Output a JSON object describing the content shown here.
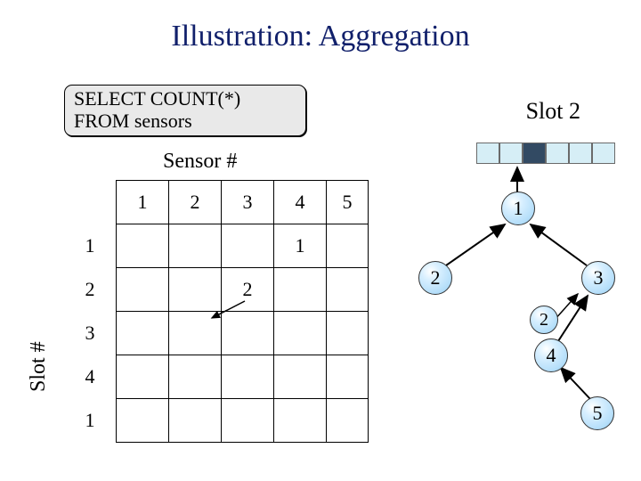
{
  "title": "Illustration: Aggregation",
  "sql": {
    "line1": "SELECT COUNT(*)",
    "line2": "FROM sensors"
  },
  "sensor_header": "Sensor #",
  "slot_axis": "Slot #",
  "col_headers": [
    "1",
    "2",
    "3",
    "4",
    "5"
  ],
  "row_headers": [
    "1",
    "2",
    "3",
    "4",
    "1"
  ],
  "cell_r1c4": "1",
  "cell_r2c3": "2",
  "slot2_label": "Slot 2",
  "slot2_cells": [
    false,
    false,
    true,
    false,
    false,
    false
  ],
  "nodes": {
    "n1": "1",
    "n2": "2",
    "n3": "3",
    "n4": "4",
    "n5": "5",
    "nR2": "2"
  }
}
